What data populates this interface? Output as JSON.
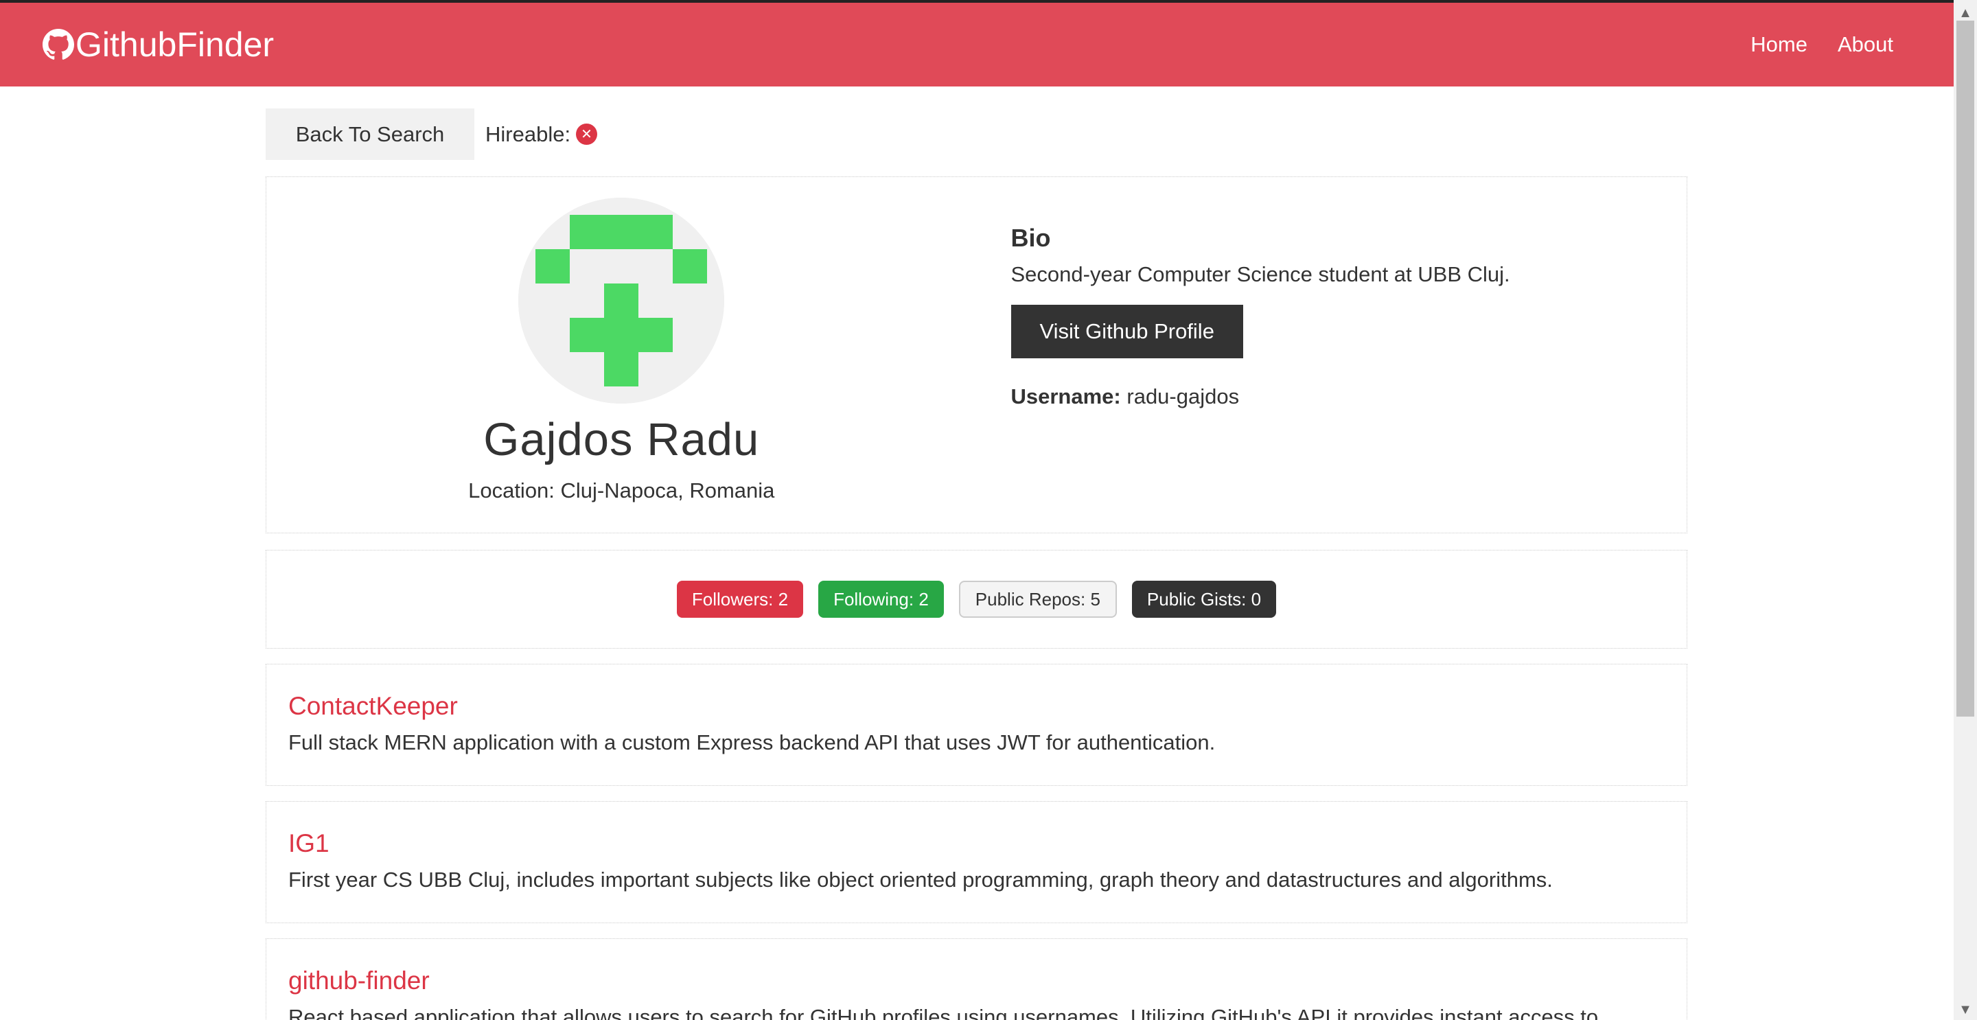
{
  "navbar": {
    "brand": "GithubFinder",
    "links": [
      {
        "label": "Home"
      },
      {
        "label": "About"
      }
    ],
    "color": "#e04a58"
  },
  "topbar": {
    "back_label": "Back To Search",
    "hireable_label": "Hireable:",
    "hireable_icon": "x-circle-icon"
  },
  "profile": {
    "name": "Gajdos Radu",
    "location": "Location: Cluj-Napoca, Romania",
    "bio_heading": "Bio",
    "bio": "Second-year Computer Science student at UBB Cluj.",
    "visit_label": "Visit Github Profile",
    "username_label": "Username:",
    "username": "radu-gajdos"
  },
  "badges": [
    {
      "label": "Followers: 2",
      "style": "red"
    },
    {
      "label": "Following: 2",
      "style": "green"
    },
    {
      "label": "Public Repos: 5",
      "style": "light"
    },
    {
      "label": "Public Gists: 0",
      "style": "dark"
    }
  ],
  "repos": [
    {
      "name": "ContactKeeper",
      "description": "Full stack MERN application with a custom Express backend API that uses JWT for authentication."
    },
    {
      "name": "IG1",
      "description": "First year CS UBB Cluj, includes important subjects like object oriented programming, graph theory and datastructures and algorithms."
    },
    {
      "name": "github-finder",
      "description": "React based application that allows users to search for GitHub profiles using usernames. Utilizing GitHub's API it provides instant access to"
    }
  ]
}
